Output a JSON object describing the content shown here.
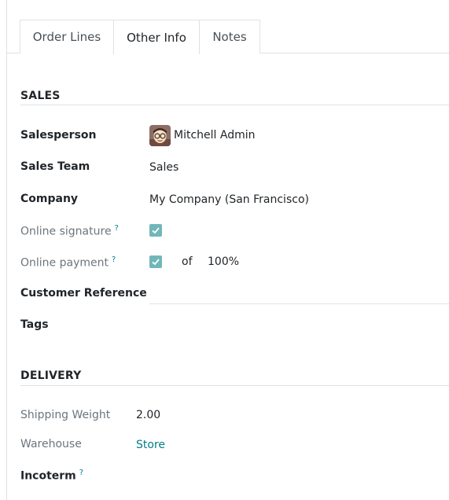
{
  "tabs": [
    {
      "label": "Order Lines",
      "active": false
    },
    {
      "label": "Other Info",
      "active": true
    },
    {
      "label": "Notes",
      "active": false
    }
  ],
  "sales": {
    "section_title": "SALES",
    "salesperson_label": "Salesperson",
    "salesperson_value": "Mitchell Admin",
    "sales_team_label": "Sales Team",
    "sales_team_value": "Sales",
    "company_label": "Company",
    "company_value": "My Company (San Francisco)",
    "online_signature_label": "Online signature",
    "online_signature_checked": true,
    "online_payment_label": "Online payment",
    "online_payment_checked": true,
    "of_text": "of",
    "payment_percent": "100%",
    "customer_reference_label": "Customer Reference",
    "customer_reference_value": "",
    "tags_label": "Tags",
    "help_mark": "?"
  },
  "delivery": {
    "section_title": "DELIVERY",
    "shipping_weight_label": "Shipping Weight",
    "shipping_weight_value": "2.00",
    "warehouse_label": "Warehouse",
    "warehouse_value": "Store",
    "incoterm_label": "Incoterm"
  },
  "colors": {
    "accent": "#017e84",
    "checkbox": "#71b7b9",
    "border": "#dee2e6",
    "muted_text": "#6c757d"
  }
}
